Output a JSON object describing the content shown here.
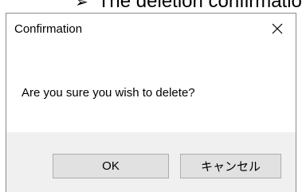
{
  "background": {
    "caption_arrow": "➢",
    "caption_text": "The deletion confirmation"
  },
  "dialog": {
    "title": "Confirmation",
    "close_icon": "close-icon",
    "message": "Are you sure you wish to delete?",
    "ok_label": "OK",
    "cancel_label": "キャンセル"
  },
  "colors": {
    "footer_bg": "#f0f0f0",
    "button_bg": "#e1e1e1",
    "button_border": "#adadad",
    "dialog_border": "#8a8a8a"
  }
}
